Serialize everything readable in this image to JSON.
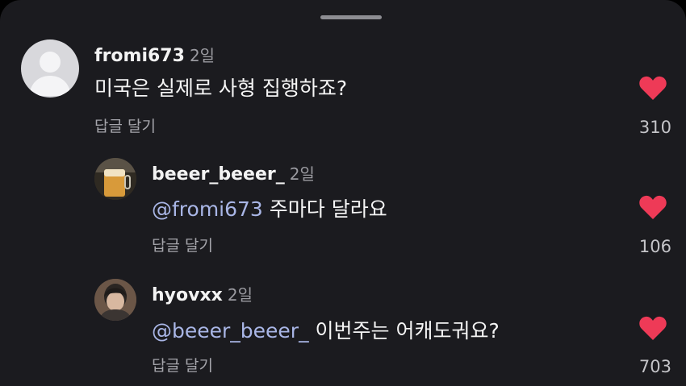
{
  "colors": {
    "background": "#1b1b1f",
    "heart": "#ee3a57",
    "mention": "#a9b6e6"
  },
  "comments": [
    {
      "username": "fromi673",
      "time": "2일",
      "mention": "",
      "text": "미국은 실제로 사형 집행하죠?",
      "reply_label": "답글 달기",
      "likes": "310",
      "like_icon": "heart-icon"
    },
    {
      "username": "beeer_beeer_",
      "time": "2일",
      "mention": "@fromi673",
      "text": "주마다 달라요",
      "reply_label": "답글 달기",
      "likes": "106",
      "like_icon": "heart-icon"
    },
    {
      "username": "hyovxx",
      "time": "2일",
      "mention": "@beeer_beeer_",
      "text": "이번주는 어캐도궈요?",
      "reply_label": "답글 달기",
      "likes": "703",
      "like_icon": "heart-icon"
    }
  ]
}
